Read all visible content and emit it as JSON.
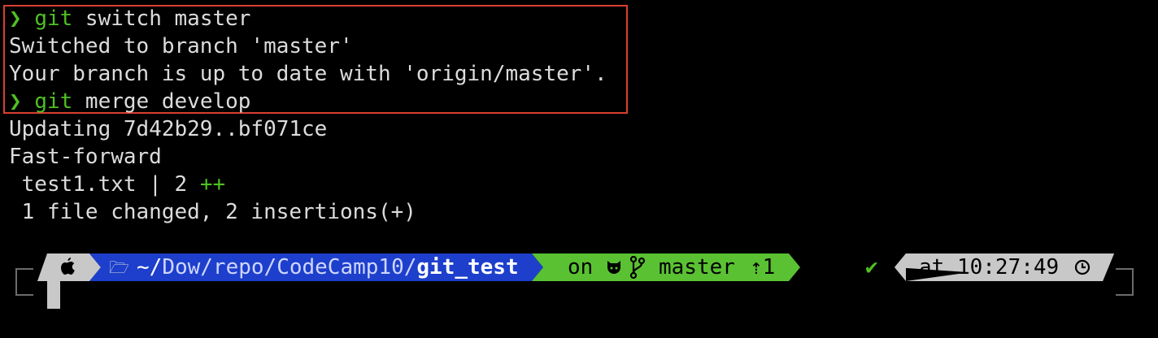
{
  "terminal": {
    "lines": [
      {
        "prompt": "❯",
        "cmd": "git",
        "args": " switch master"
      },
      {
        "text": "Switched to branch 'master'"
      },
      {
        "text": "Your branch is up to date with 'origin/master'."
      },
      {
        "prompt": "❯",
        "cmd": "git",
        "args": " merge develop"
      },
      {
        "text": "Updating 7d42b29..bf071ce"
      },
      {
        "text": "Fast-forward"
      },
      {
        "text": " test1.txt | 2 ",
        "extra": "++"
      },
      {
        "text": " 1 file changed, 2 insertions(+)"
      }
    ]
  },
  "prompt_bar": {
    "os_icon": "apple-icon",
    "folder_icon": "folder-open-icon",
    "path_prefix": "~/",
    "path_mid": "Dow/repo/CodeCamp10/",
    "path_last": "git_test",
    "vcs_on": "on",
    "github_icon": "github-icon",
    "branch_icon": "git-branch-icon",
    "branch": "master",
    "ahead": "⇡1",
    "status_check": "✔",
    "time_label": "at 10:27:49",
    "clock_icon": "clock-icon"
  },
  "colors": {
    "green": "#4fc021",
    "highlight_border": "#d8402f",
    "dir_blue": "#1d3fcc",
    "vcs_green": "#5ac232",
    "time_gray": "#c8c8c8",
    "os_gray": "#c8c8c8"
  }
}
